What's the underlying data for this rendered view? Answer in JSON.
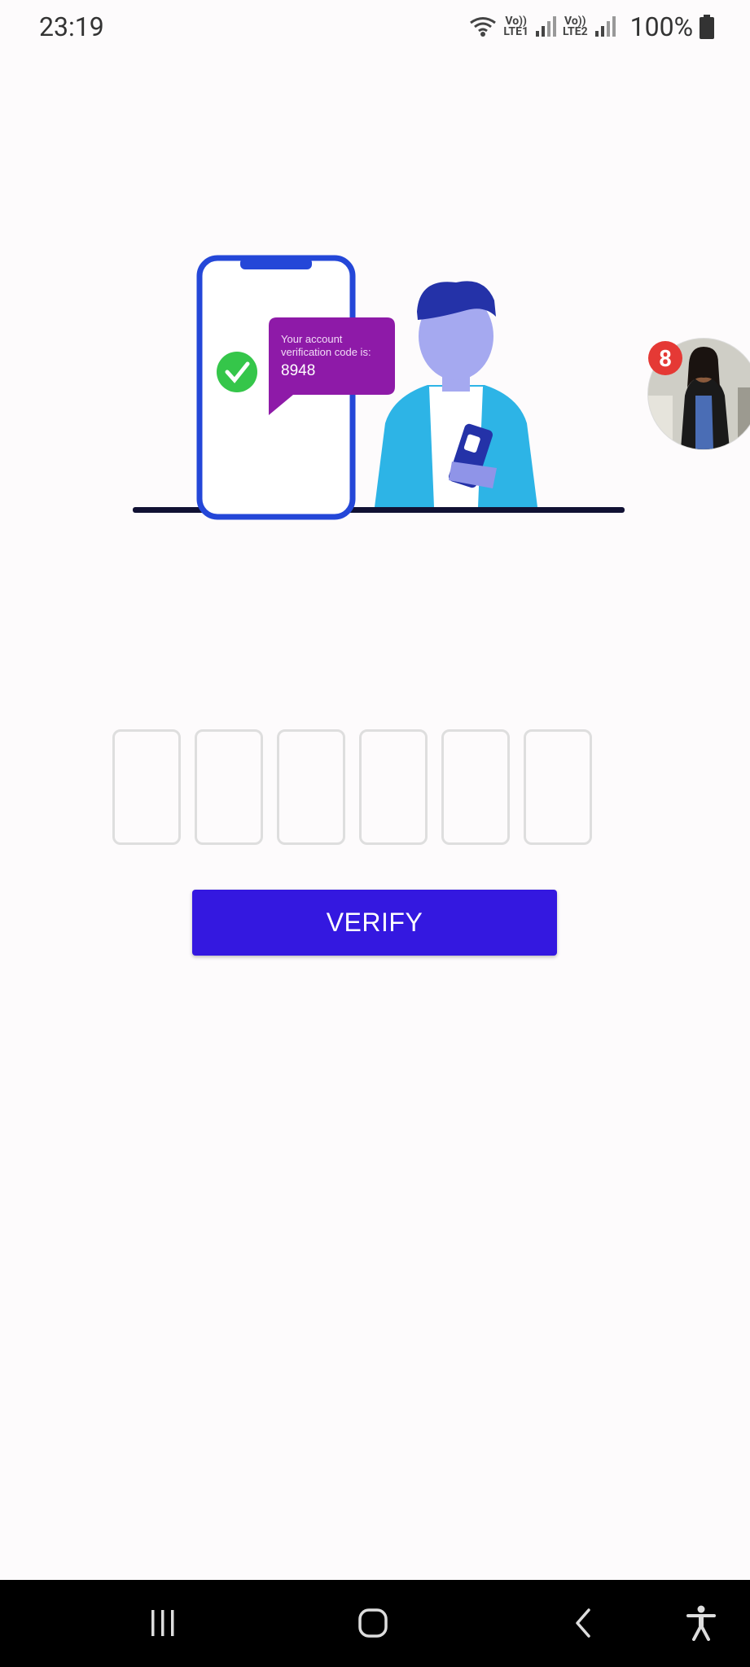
{
  "status_bar": {
    "time": "23:19",
    "net1_top": "Vo))",
    "net1_bottom": "LTE1",
    "net2_top": "Vo))",
    "net2_bottom": "LTE2",
    "battery": "100%"
  },
  "illustration": {
    "sms_line1": "Your account",
    "sms_line2": "verification code is:",
    "sms_code": "8948"
  },
  "chat_head": {
    "badge_count": "8"
  },
  "otp": {
    "digits": [
      "",
      "",
      "",
      "",
      "",
      ""
    ]
  },
  "verify_button": {
    "label": "VERIFY"
  },
  "nav_bar": {
    "icons": [
      "recent-apps-icon",
      "home-icon",
      "back-icon",
      "accessibility-icon"
    ]
  },
  "colors": {
    "accent": "#3418e0",
    "background": "#fdfbfc",
    "badge": "#e53935",
    "sms_bubble": "#8e1aa8"
  }
}
